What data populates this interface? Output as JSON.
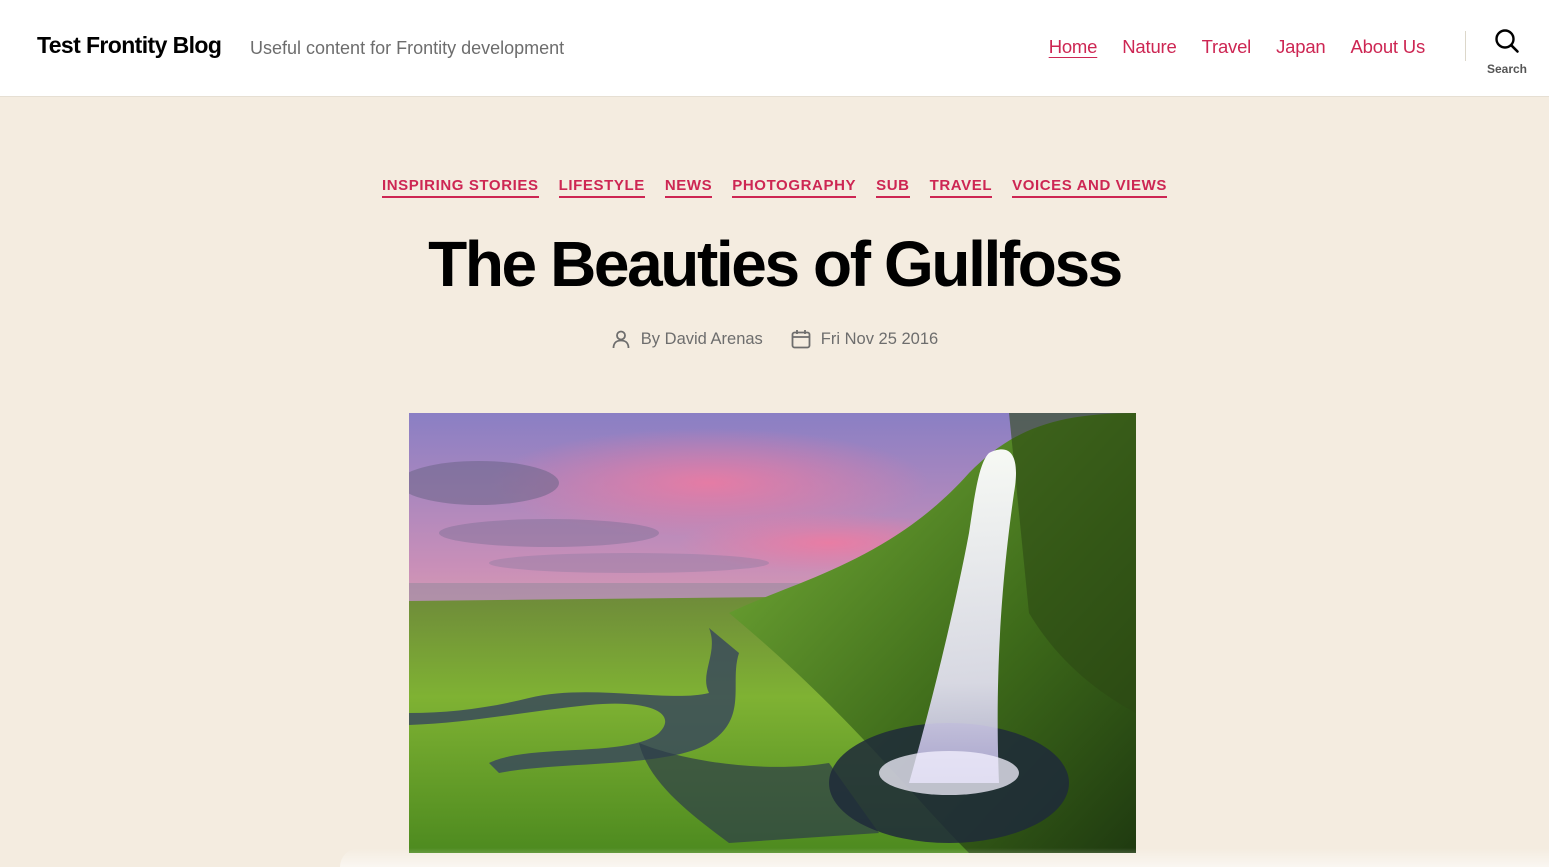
{
  "header": {
    "site_title": "Test Frontity Blog",
    "site_description": "Useful content for Frontity development",
    "nav": [
      {
        "label": "Home",
        "current": true
      },
      {
        "label": "Nature",
        "current": false
      },
      {
        "label": "Travel",
        "current": false
      },
      {
        "label": "Japan",
        "current": false
      },
      {
        "label": "About Us",
        "current": false
      }
    ],
    "search_label": "Search",
    "accent_color": "#cd2653"
  },
  "post": {
    "categories": [
      "INSPIRING STORIES",
      "LIFESTYLE",
      "NEWS",
      "PHOTOGRAPHY",
      "SUB",
      "TRAVEL",
      "VOICES AND VIEWS"
    ],
    "title": "The Beauties of Gullfoss",
    "author_prefix": "By",
    "author": "David Arenas",
    "date": "Fri Nov 25 2016",
    "icons": {
      "author": "user-icon",
      "date": "calendar-icon"
    }
  },
  "colors": {
    "page_background": "#f4ece0",
    "header_background": "#ffffff",
    "accent": "#cd2653",
    "muted_text": "#6d6d6d"
  }
}
